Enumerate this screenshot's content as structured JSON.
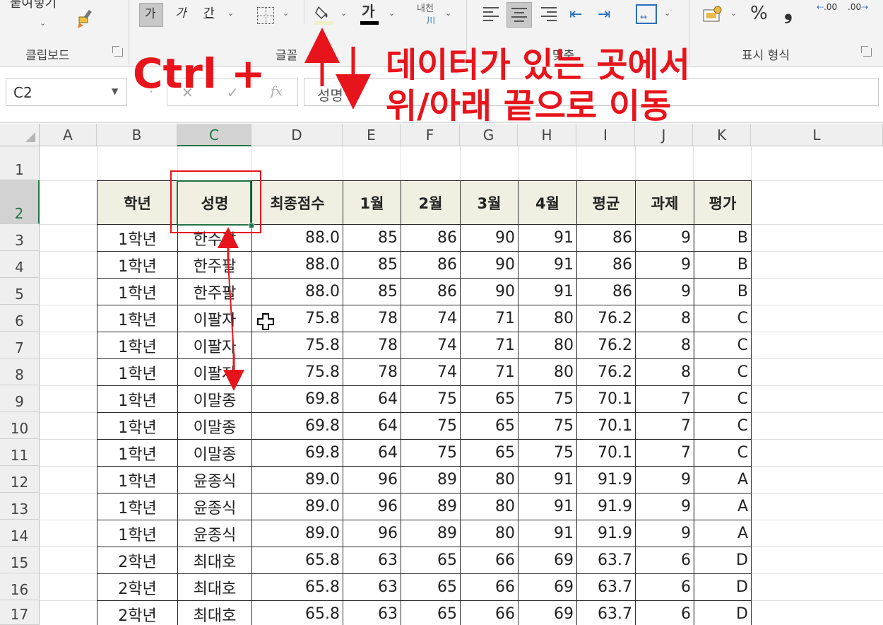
{
  "ribbon": {
    "paste_label": "붙여넣기",
    "clipboard_group": "클립보드",
    "font_group": "글꼴",
    "align_group": "맞춤",
    "number_group": "표시 형식",
    "font_bold_glyph": "가",
    "font_italic_glyph": "가",
    "font_underline_glyph": "간",
    "font_color_glyph": "가",
    "phonetic_label": "내천",
    "percent_glyph": "%",
    "comma_glyph": "❟",
    "decimal_increase": ".00",
    "decimal_decrease": ".00"
  },
  "formula_bar": {
    "name_box": "C2",
    "fx_label": "fx",
    "cancel_glyph": "✕",
    "enter_glyph": "✓",
    "content": "성명"
  },
  "columns": [
    "A",
    "B",
    "C",
    "D",
    "E",
    "F",
    "G",
    "H",
    "I",
    "J",
    "K",
    "L"
  ],
  "rows": [
    "1",
    "2",
    "3",
    "4",
    "5",
    "6",
    "7",
    "8",
    "9",
    "10",
    "11",
    "12",
    "13",
    "14",
    "15",
    "16",
    "17"
  ],
  "table": {
    "headers": [
      "학년",
      "성명",
      "최종점수",
      "1월",
      "2월",
      "3월",
      "4월",
      "평균",
      "과제",
      "평가"
    ],
    "rows": [
      [
        "1학년",
        "한주팔",
        "88.0",
        "85",
        "86",
        "90",
        "91",
        "86",
        "9",
        "B"
      ],
      [
        "1학년",
        "한주팔",
        "88.0",
        "85",
        "86",
        "90",
        "91",
        "86",
        "9",
        "B"
      ],
      [
        "1학년",
        "한주팔",
        "88.0",
        "85",
        "86",
        "90",
        "91",
        "86",
        "9",
        "B"
      ],
      [
        "1학년",
        "이팔자",
        "75.8",
        "78",
        "74",
        "71",
        "80",
        "76.2",
        "8",
        "C"
      ],
      [
        "1학년",
        "이팔자",
        "75.8",
        "78",
        "74",
        "71",
        "80",
        "76.2",
        "8",
        "C"
      ],
      [
        "1학년",
        "이팔자",
        "75.8",
        "78",
        "74",
        "71",
        "80",
        "76.2",
        "8",
        "C"
      ],
      [
        "1학년",
        "이말종",
        "69.8",
        "64",
        "75",
        "65",
        "75",
        "70.1",
        "7",
        "C"
      ],
      [
        "1학년",
        "이말종",
        "69.8",
        "64",
        "75",
        "65",
        "75",
        "70.1",
        "7",
        "C"
      ],
      [
        "1학년",
        "이말종",
        "69.8",
        "64",
        "75",
        "65",
        "75",
        "70.1",
        "7",
        "C"
      ],
      [
        "1학년",
        "윤종식",
        "89.0",
        "96",
        "89",
        "80",
        "91",
        "91.9",
        "9",
        "A"
      ],
      [
        "1학년",
        "윤종식",
        "89.0",
        "96",
        "89",
        "80",
        "91",
        "91.9",
        "9",
        "A"
      ],
      [
        "1학년",
        "윤종식",
        "89.0",
        "96",
        "89",
        "80",
        "91",
        "91.9",
        "9",
        "A"
      ],
      [
        "2학년",
        "최대호",
        "65.8",
        "63",
        "65",
        "66",
        "69",
        "63.7",
        "6",
        "D"
      ],
      [
        "2학년",
        "최대호",
        "65.8",
        "63",
        "65",
        "66",
        "69",
        "63.7",
        "6",
        "D"
      ],
      [
        "2학년",
        "최대호",
        "65.8",
        "63",
        "65",
        "66",
        "69",
        "63.7",
        "6",
        "D"
      ]
    ]
  },
  "annotation": {
    "shortcut": "Ctrl +",
    "line1": "데이터가 있는 곳에서",
    "line2": "위/아래 끝으로 이동",
    "color": "#e8141c"
  },
  "colors": {
    "accent": "#217346",
    "header_fill": "#f1efe2"
  }
}
